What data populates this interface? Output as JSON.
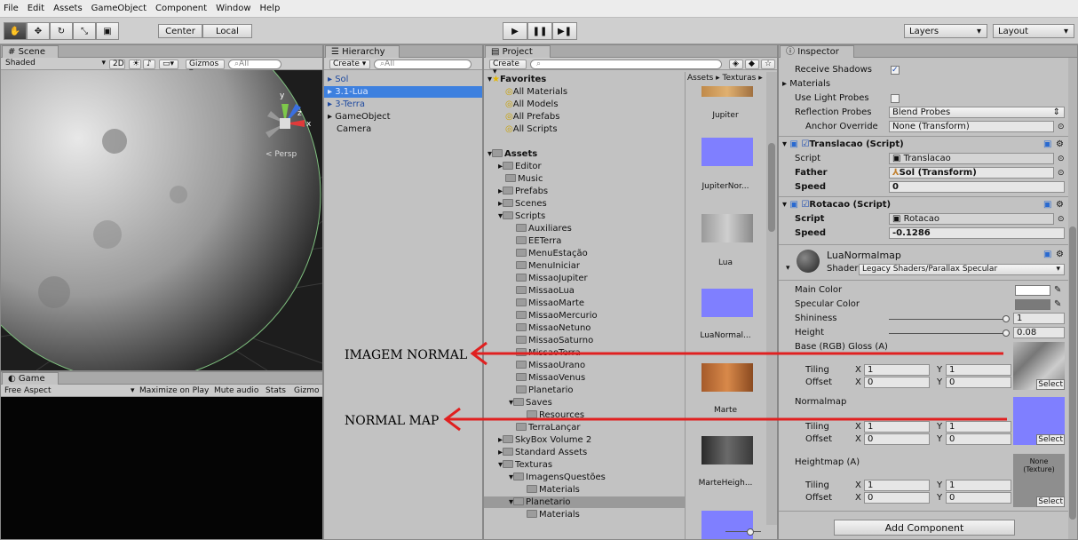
{
  "menu": [
    "File",
    "Edit",
    "Assets",
    "GameObject",
    "Component",
    "Window",
    "Help"
  ],
  "toolbar": {
    "center": "Center",
    "local": "Local",
    "layers": "Layers",
    "layout": "Layout"
  },
  "scene": {
    "tab": "Scene",
    "shading": "Shaded",
    "mode2d": "2D",
    "gizmos": "Gizmos",
    "search": "All",
    "persp": "Persp",
    "axes": {
      "x": "x",
      "y": "y",
      "z": "z"
    }
  },
  "game": {
    "tab": "Game",
    "aspect": "Free Aspect",
    "maximize": "Maximize on Play",
    "mute": "Mute audio",
    "stats": "Stats",
    "gizmos": "Gizmo"
  },
  "hierarchy": {
    "tab": "Hierarchy",
    "create": "Create",
    "search": "All",
    "items": [
      "Sol",
      "3.1-Lua",
      "3-Terra",
      "GameObject",
      "Camera"
    ]
  },
  "project": {
    "tab": "Project",
    "create": "Create",
    "breadcrumb": "Assets ▸ Texturas ▸",
    "favorites_title": "Favorites",
    "favorites": [
      "All Materials",
      "All Models",
      "All Prefabs",
      "All Scripts"
    ],
    "assets_title": "Assets",
    "tree": [
      "Editor",
      "Music",
      "Prefabs",
      "Scenes",
      "Scripts",
      "Auxiliares",
      "EETerra",
      "MenuEstação",
      "MenuIniciar",
      "MissaoJupiter",
      "MissaoLua",
      "MissaoMarte",
      "MissaoMercurio",
      "MissaoNetuno",
      "MissaoSaturno",
      "MissaoTerra",
      "MissaoUrano",
      "MissaoVenus",
      "Planetario",
      "Saves",
      "Resources",
      "TerraLançar",
      "SkyBox Volume 2",
      "Standard Assets",
      "Texturas",
      "ImagensQuestões",
      "Materials",
      "Planetario",
      "Materials"
    ],
    "thumbs": [
      "Jupiter",
      "JupiterNor...",
      "Lua",
      "LuaNormal...",
      "Marte",
      "MarteHeigh..."
    ]
  },
  "inspector": {
    "tab": "Inspector",
    "receive_shadows": "Receive Shadows",
    "materials": "Materials",
    "use_light_probes": "Use Light Probes",
    "reflection_probes": "Reflection Probes",
    "reflection_value": "Blend Probes",
    "anchor_override": "Anchor Override",
    "anchor_value": "None (Transform)",
    "translacao": {
      "title": "Translacao (Script)",
      "script_lbl": "Script",
      "script_val": "Translacao",
      "father_lbl": "Father",
      "father_val": "Sol (Transform)",
      "speed_lbl": "Speed",
      "speed_val": "0"
    },
    "rotacao": {
      "title": "Rotacao (Script)",
      "script_lbl": "Script",
      "script_val": "Rotacao",
      "speed_lbl": "Speed",
      "speed_val": "-0.1286"
    },
    "material": {
      "name": "LuaNormalmap",
      "shader_lbl": "Shader",
      "shader_val": "Legacy Shaders/Parallax Specular",
      "main_color": "Main Color",
      "spec_color": "Specular Color",
      "shininess": "Shininess",
      "shininess_val": "1",
      "height": "Height",
      "height_val": "0.08",
      "base": "Base (RGB) Gloss (A)",
      "normalmap": "Normalmap",
      "heightmap": "Heightmap (A)",
      "none_texture": "None (Texture)",
      "tiling": "Tiling",
      "offset": "Offset",
      "x": "X",
      "y": "Y",
      "one": "1",
      "zero": "0",
      "select": "Select"
    },
    "add_component": "Add Component"
  },
  "annotations": {
    "imagem_normal": "IMAGEM NORMAL",
    "normal_map": "NORMAL MAP"
  },
  "colors": {
    "selection": "#3d80df",
    "arrow": "#e02020",
    "normal_blue": "#7f7fff"
  }
}
